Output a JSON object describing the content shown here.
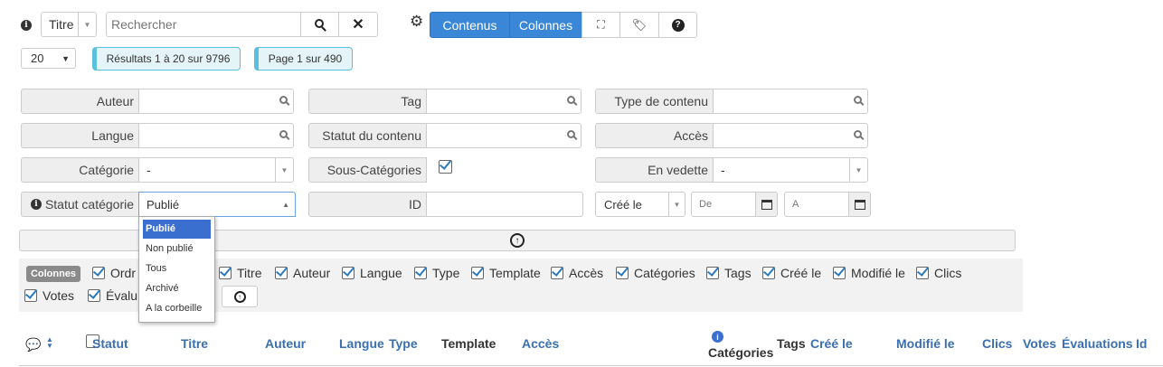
{
  "toolbar": {
    "search_field_select": "Titre",
    "search_placeholder": "Rechercher",
    "tab_contenus": "Contenus",
    "tab_colonnes": "Colonnes"
  },
  "paging": {
    "per_page": "20",
    "results": "Résultats 1 à 20 sur 9796",
    "page": "Page 1 sur 490"
  },
  "filters": {
    "auteur": "Auteur",
    "tag": "Tag",
    "type_contenu": "Type de contenu",
    "langue": "Langue",
    "statut_contenu": "Statut du contenu",
    "acces": "Accès",
    "categorie": "Catégorie",
    "categorie_value": "-",
    "sous_categories": "Sous-Catégories",
    "en_vedette": "En vedette",
    "en_vedette_value": "-",
    "statut_categorie": "Statut catégorie",
    "statut_categorie_value": "Publié",
    "id": "ID",
    "date_field": "Créé le",
    "date_from_placeholder": "De",
    "date_to_placeholder": "A"
  },
  "dropdown": {
    "options": [
      "Publié",
      "Non publié",
      "Tous",
      "Archivé",
      "A la corbeille"
    ]
  },
  "columns": {
    "badge": "Colonnes",
    "items": [
      "Ordre",
      "Titre",
      "Auteur",
      "Langue",
      "Type",
      "Template",
      "Accès",
      "Catégories",
      "Tags",
      "Créé le",
      "Modifié le",
      "Clics",
      "Votes",
      "Évaluations"
    ],
    "visible_partial": {
      "ordre": "Ordr",
      "evaluations": "Évalu"
    }
  },
  "table_headers": {
    "statut": "Statut",
    "titre": "Titre",
    "auteur": "Auteur",
    "langue": "Langue",
    "type": "Type",
    "template": "Template",
    "acces": "Accès",
    "categories": "Catégories",
    "tags": "Tags",
    "cree_le": "Créé le",
    "modifie_le": "Modifié le",
    "clics": "Clics",
    "votes": "Votes",
    "evaluations": "Évaluations",
    "id": "Id"
  },
  "colors": {
    "accent": "#3a87d8",
    "info_badge_bg": "#e4f4f9",
    "info_badge_border": "#5bc0de",
    "header_link": "#3a6fb0"
  }
}
